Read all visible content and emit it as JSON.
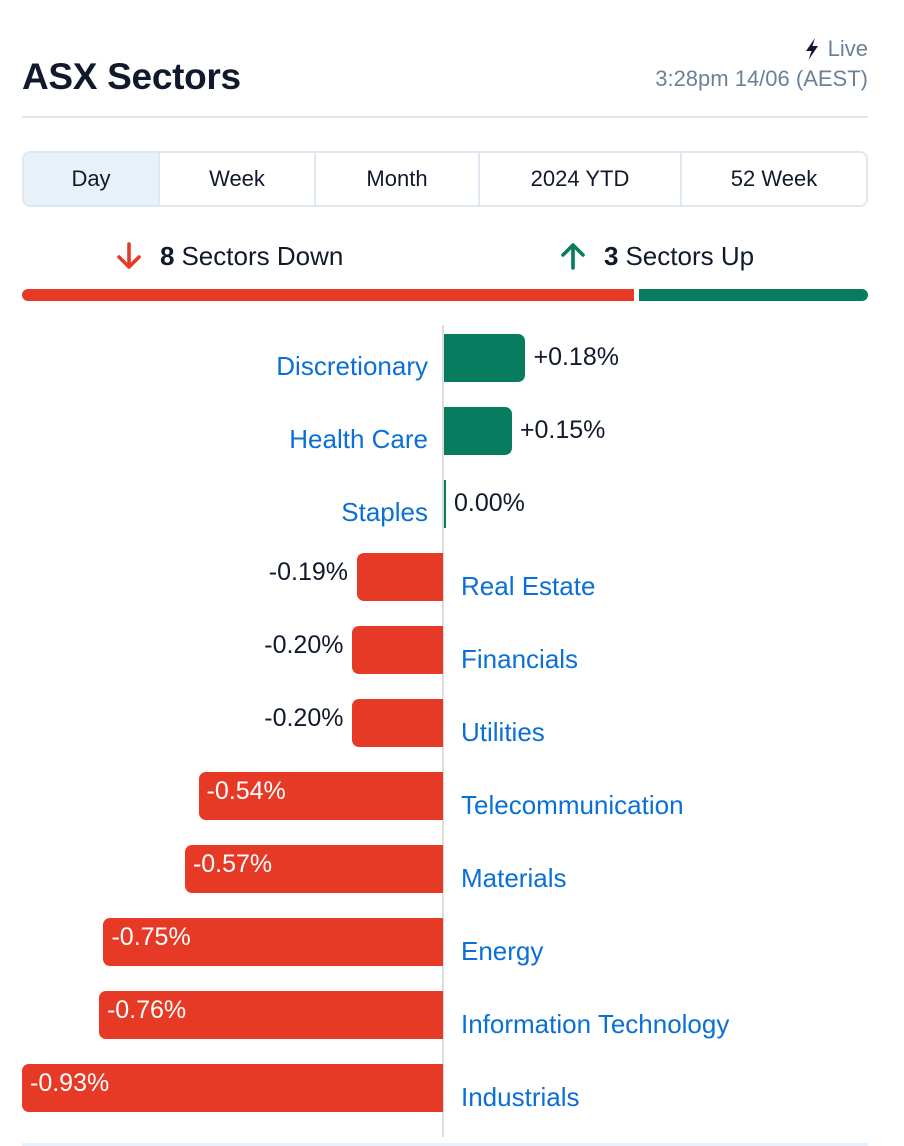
{
  "header": {
    "title": "ASX Sectors",
    "live_icon": "lightning-bolt-icon",
    "live_label": "Live",
    "timestamp": "3:28pm 14/06 (AEST)"
  },
  "tabs": [
    {
      "label": "Day",
      "active": true
    },
    {
      "label": "Week",
      "active": false
    },
    {
      "label": "Month",
      "active": false
    },
    {
      "label": "2024 YTD",
      "active": false
    },
    {
      "label": "52 Week",
      "active": false
    }
  ],
  "summary": {
    "down_icon": "arrow-down-icon",
    "down_count": "8",
    "down_label": "Sectors Down",
    "up_icon": "arrow-up-icon",
    "up_count": "3",
    "up_label": "Sectors Up",
    "down_fraction": 0.7273,
    "up_fraction": 0.2727
  },
  "colors": {
    "positive": "#077c5e",
    "negative": "#e63a27",
    "link": "#0a6fd6",
    "muted": "#6a8299"
  },
  "chart_data": {
    "type": "bar",
    "orientation": "horizontal-diverging",
    "title": "ASX Sectors",
    "xlabel": "",
    "ylabel": "",
    "unit": "%",
    "categories": [
      "Discretionary",
      "Health Care",
      "Staples",
      "Real Estate",
      "Financials",
      "Utilities",
      "Telecommunication",
      "Materials",
      "Energy",
      "Information Technology",
      "Industrials"
    ],
    "values": [
      0.18,
      0.15,
      0.0,
      -0.19,
      -0.2,
      -0.2,
      -0.54,
      -0.57,
      -0.75,
      -0.76,
      -0.93
    ],
    "value_labels": [
      "+0.18%",
      "+0.15%",
      "0.00%",
      "-0.19%",
      "-0.20%",
      "-0.20%",
      "-0.54%",
      "-0.57%",
      "-0.75%",
      "-0.76%",
      "-0.93%"
    ],
    "xlim": [
      -0.93,
      0.93
    ],
    "grid": false,
    "legend": "none"
  }
}
